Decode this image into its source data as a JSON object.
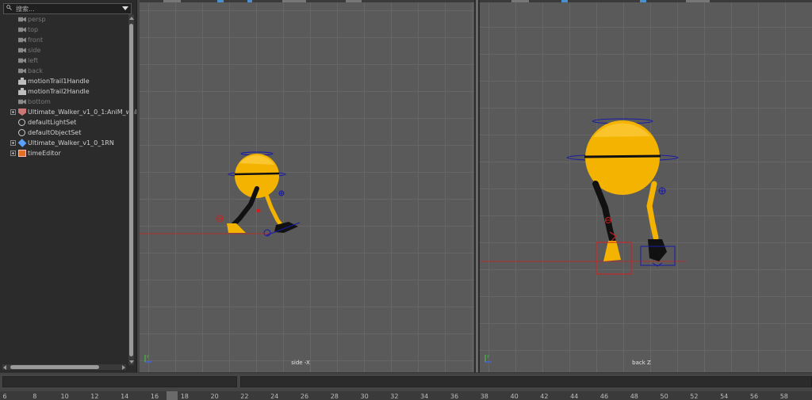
{
  "outliner": {
    "search_placeholder": "搜索...",
    "items": [
      {
        "label": "persp",
        "icon": "camera-icon",
        "dim": true,
        "expandable": false
      },
      {
        "label": "top",
        "icon": "camera-icon",
        "dim": true,
        "expandable": false
      },
      {
        "label": "front",
        "icon": "camera-icon",
        "dim": true,
        "expandable": false
      },
      {
        "label": "side",
        "icon": "camera-icon",
        "dim": true,
        "expandable": false
      },
      {
        "label": "left",
        "icon": "camera-icon",
        "dim": true,
        "expandable": false
      },
      {
        "label": "back",
        "icon": "camera-icon",
        "dim": true,
        "expandable": false
      },
      {
        "label": "motionTrail1Handle",
        "icon": "motion-trail-icon",
        "dim": false,
        "expandable": false
      },
      {
        "label": "motionTrail2Handle",
        "icon": "motion-trail-icon",
        "dim": false,
        "expandable": false
      },
      {
        "label": "bottom",
        "icon": "camera-icon",
        "dim": true,
        "expandable": false
      },
      {
        "label": "Ultimate_Walker_v1_0_1:AniM_wal",
        "icon": "character-icon",
        "dim": false,
        "expandable": true
      },
      {
        "label": "defaultLightSet",
        "icon": "set-icon",
        "dim": false,
        "expandable": false
      },
      {
        "label": "defaultObjectSet",
        "icon": "set-icon",
        "dim": false,
        "expandable": false
      },
      {
        "label": "Ultimate_Walker_v1_0_1RN",
        "icon": "reference-icon",
        "dim": false,
        "expandable": true
      },
      {
        "label": "timeEditor",
        "icon": "time-editor-icon",
        "dim": false,
        "expandable": true
      }
    ]
  },
  "viewports": {
    "side": {
      "label": "side -X"
    },
    "back": {
      "label": "back Z"
    }
  },
  "colors": {
    "character_yellow": "#f5b800",
    "trail_blue": "#1a1aa8",
    "handle_red": "#d41e1e",
    "ground_line": "#b03030"
  },
  "timeline": {
    "ticks": [
      "6",
      "8",
      "10",
      "12",
      "14",
      "16",
      "18",
      "20",
      "22",
      "24",
      "26",
      "28",
      "30",
      "32",
      "34",
      "36",
      "38",
      "40",
      "42",
      "44",
      "46",
      "48",
      "50",
      "52",
      "54",
      "56",
      "58"
    ]
  }
}
